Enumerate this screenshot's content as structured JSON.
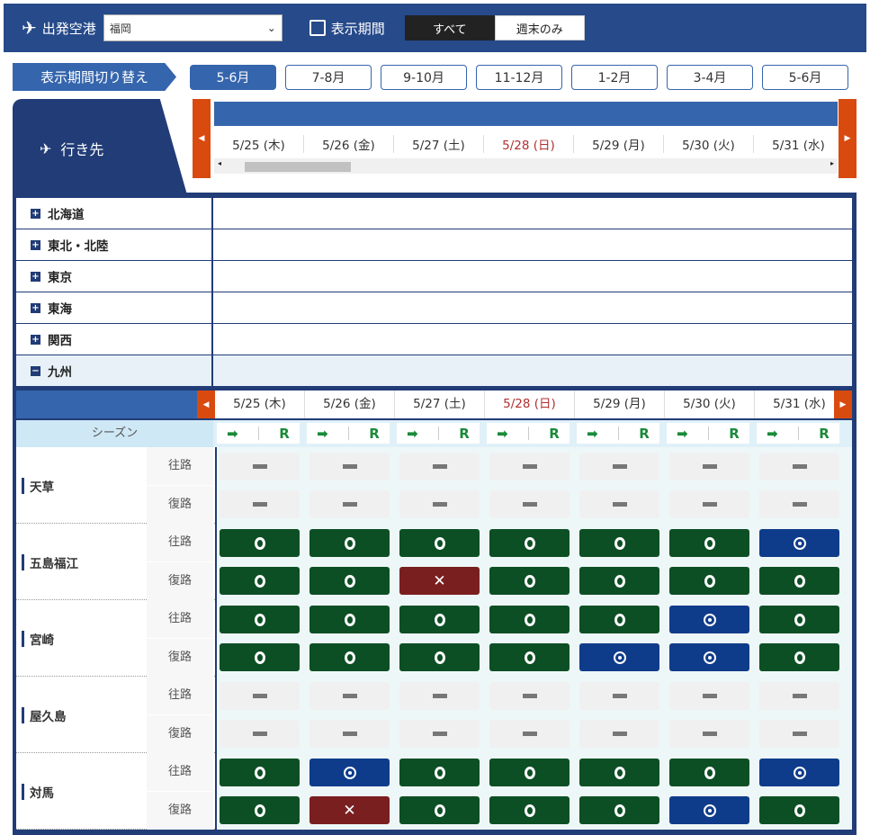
{
  "header": {
    "departure_label": "出発空港",
    "departure_value": "福岡",
    "period_label": "表示期間",
    "period_options": [
      "すべて",
      "週末のみ"
    ],
    "period_selected": "すべて"
  },
  "period_switch": {
    "label": "表示期間切り替え",
    "options": [
      "5-6月",
      "7-8月",
      "9-10月",
      "11-12月",
      "1-2月",
      "3-4月",
      "5-6月"
    ],
    "selected_index": 0
  },
  "destination_label": "行き先",
  "dates": [
    {
      "label": "5/25 (木)",
      "sunday": false
    },
    {
      "label": "5/26 (金)",
      "sunday": false
    },
    {
      "label": "5/27 (土)",
      "sunday": false
    },
    {
      "label": "5/28 (日)",
      "sunday": true
    },
    {
      "label": "5/29 (月)",
      "sunday": false
    },
    {
      "label": "5/30 (火)",
      "sunday": false
    },
    {
      "label": "5/31 (水)",
      "sunday": false
    }
  ],
  "regions": [
    {
      "name": "北海道",
      "open": false
    },
    {
      "name": "東北・北陸",
      "open": false
    },
    {
      "name": "東京",
      "open": false
    },
    {
      "name": "東海",
      "open": false
    },
    {
      "name": "関西",
      "open": false
    },
    {
      "name": "九州",
      "open": true
    }
  ],
  "season_label": "シーズン",
  "season_marks": [
    "➡",
    "R"
  ],
  "directions": [
    "往路",
    "復路"
  ],
  "destinations": [
    {
      "name": "天草",
      "outbound": [
        "-",
        "-",
        "-",
        "-",
        "-",
        "-",
        "-"
      ],
      "return": [
        "-",
        "-",
        "-",
        "-",
        "-",
        "-",
        "-"
      ]
    },
    {
      "name": "五島福江",
      "outbound": [
        "o",
        "o",
        "o",
        "o",
        "o",
        "o",
        "d"
      ],
      "return": [
        "o",
        "o",
        "x",
        "o",
        "o",
        "o",
        "o"
      ]
    },
    {
      "name": "宮崎",
      "outbound": [
        "o",
        "o",
        "o",
        "o",
        "o",
        "d",
        "o"
      ],
      "return": [
        "o",
        "o",
        "o",
        "o",
        "d",
        "d",
        "o"
      ]
    },
    {
      "name": "屋久島",
      "outbound": [
        "-",
        "-",
        "-",
        "-",
        "-",
        "-",
        "-"
      ],
      "return": [
        "-",
        "-",
        "-",
        "-",
        "-",
        "-",
        "-"
      ]
    },
    {
      "name": "対馬",
      "outbound": [
        "o",
        "d",
        "o",
        "o",
        "o",
        "o",
        "d"
      ],
      "return": [
        "o",
        "x",
        "o",
        "o",
        "o",
        "d",
        "o"
      ]
    }
  ],
  "colors": {
    "navy": "#213c77",
    "blue": "#3565ad",
    "available": "#0d4f25",
    "few": "#0f3c8a",
    "full": "#7a1f1f",
    "arrow": "#d94a0f"
  }
}
